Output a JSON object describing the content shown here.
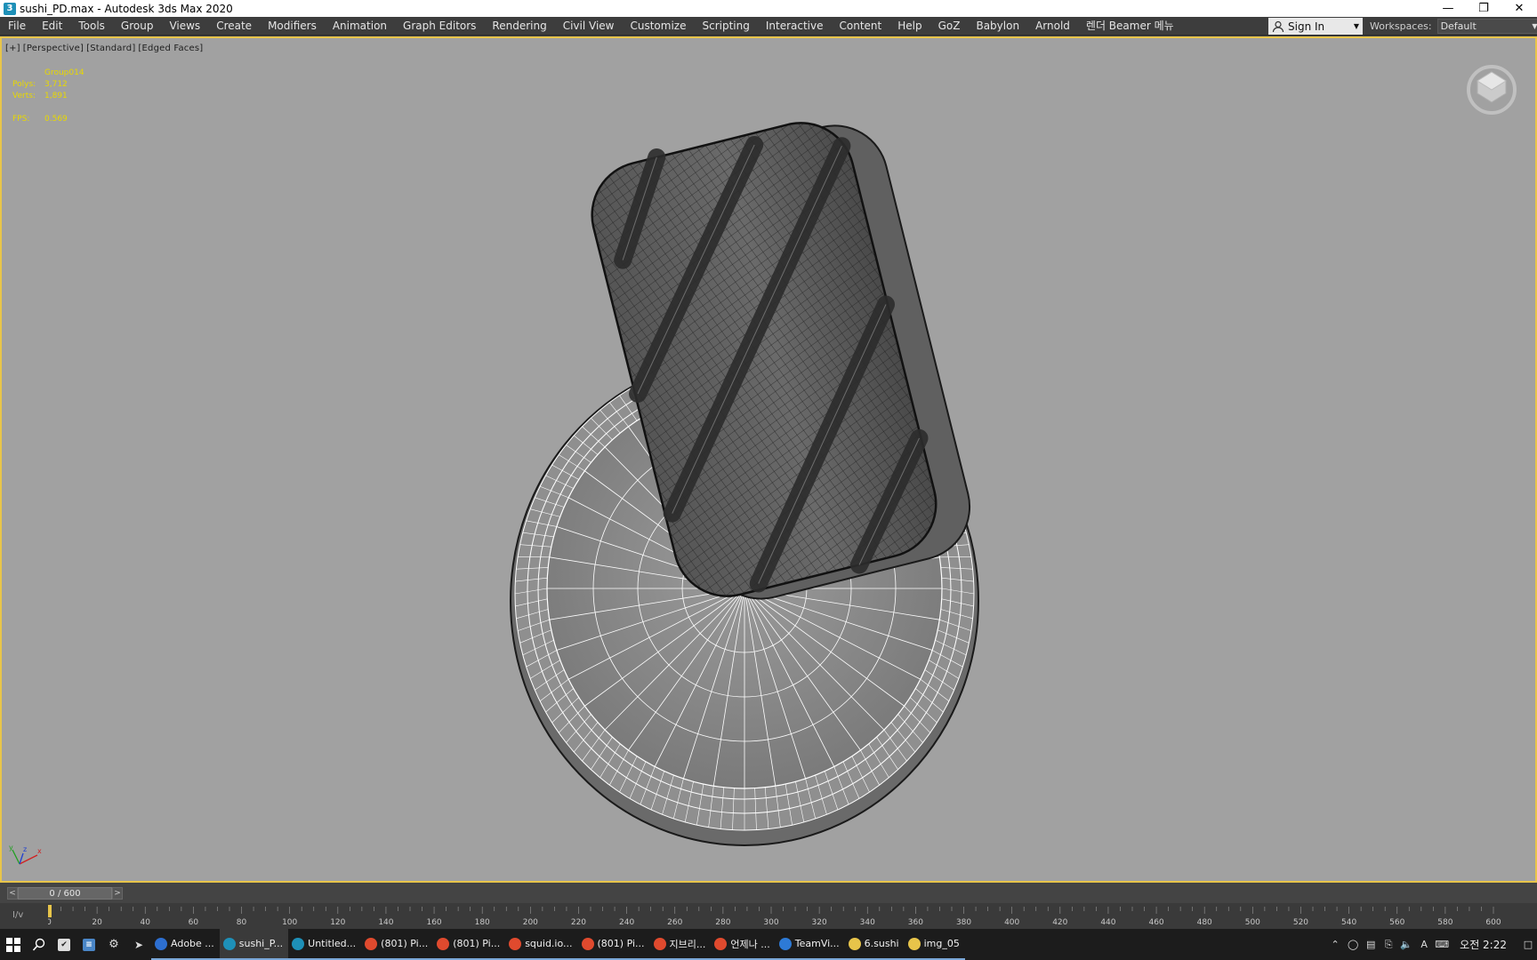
{
  "window": {
    "title": "sushi_PD.max - Autodesk 3ds Max 2020",
    "app_icon": "3"
  },
  "menu": {
    "items": [
      "File",
      "Edit",
      "Tools",
      "Group",
      "Views",
      "Create",
      "Modifiers",
      "Animation",
      "Graph Editors",
      "Rendering",
      "Civil View",
      "Customize",
      "Scripting",
      "Interactive",
      "Content",
      "Help",
      "GoZ",
      "Babylon",
      "Arnold",
      "렌더 Beamer 메뉴"
    ],
    "sign_in": "Sign In",
    "workspaces_label": "Workspaces:",
    "workspace_value": "Default"
  },
  "viewport": {
    "labels": [
      "[+]",
      "[Perspective]",
      "[Standard]",
      "[Edged Faces]"
    ],
    "stats": {
      "object": "Group014",
      "polys_label": "Polys:",
      "polys": "3,712",
      "verts_label": "Verts:",
      "verts": "1,891",
      "fps_label": "FPS:",
      "fps": "0.569"
    },
    "border_color": "#e8c54a",
    "background": "#a1a1a1"
  },
  "timeline": {
    "frame_display": "0 / 600",
    "prev": "<",
    "next": ">",
    "key_label": "I/v",
    "ticks": [
      "0",
      "20",
      "40",
      "60",
      "80",
      "100",
      "120",
      "140",
      "160",
      "180",
      "200",
      "220",
      "240",
      "260",
      "280",
      "300",
      "320",
      "340",
      "360",
      "380",
      "400",
      "420",
      "440",
      "460",
      "480",
      "500",
      "520",
      "540",
      "560",
      "580",
      "600"
    ]
  },
  "taskbar": {
    "tasks": [
      {
        "label": "Adobe ...",
        "color": "#2d6fd1",
        "active": false
      },
      {
        "label": "sushi_P...",
        "color": "#1e90b8",
        "active": true
      },
      {
        "label": "Untitled...",
        "color": "#1e90b8",
        "active": false
      },
      {
        "label": "(801) Pi...",
        "color": "#e04a2e",
        "active": false
      },
      {
        "label": "(801) Pi...",
        "color": "#e04a2e",
        "active": false
      },
      {
        "label": "squid.io...",
        "color": "#e04a2e",
        "active": false
      },
      {
        "label": "(801) Pi...",
        "color": "#e04a2e",
        "active": false
      },
      {
        "label": "지브리...",
        "color": "#e04a2e",
        "active": false
      },
      {
        "label": "언제나 ...",
        "color": "#e04a2e",
        "active": false
      },
      {
        "label": "TeamVi...",
        "color": "#2d7ad6",
        "active": false
      },
      {
        "label": "6.sushi",
        "color": "#e7c44a",
        "active": false
      },
      {
        "label": "img_05",
        "color": "#e7c44a",
        "active": false
      }
    ],
    "clock": "오전 2:22",
    "ime": "A"
  }
}
